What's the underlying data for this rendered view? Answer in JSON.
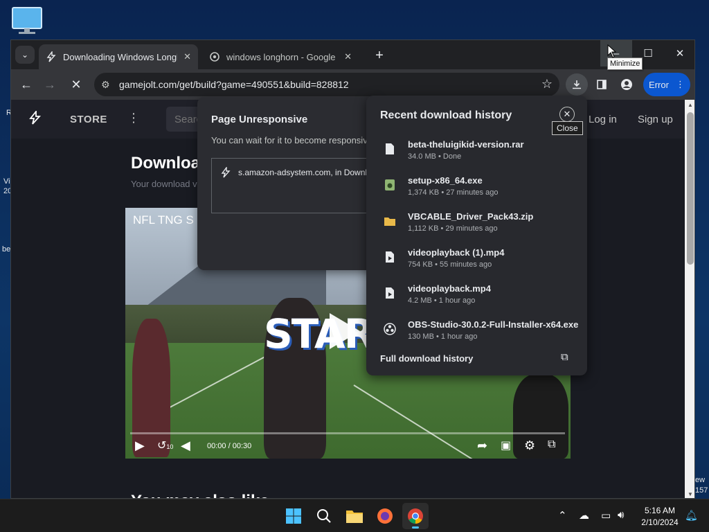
{
  "desktop": {
    "edge_labels": [
      "R",
      "Vi",
      "20",
      "be",
      "ew",
      "157"
    ]
  },
  "browser": {
    "tabs": [
      {
        "title": "Downloading Windows Longhe",
        "close": "✕"
      },
      {
        "title": "windows longhorn - Google Se",
        "close": "✕"
      }
    ],
    "new_tab": "+",
    "window_controls": {
      "minimize": "–",
      "maximize": "☐",
      "close": "✕"
    },
    "minimize_tooltip": "Minimize",
    "url": "gamejolt.com/get/build?game=490551&build=828812",
    "error_label": "Error"
  },
  "site": {
    "store_label": "STORE",
    "search_placeholder": "Search",
    "login_label": "Log in",
    "signup_label": "Sign up",
    "heading": "Downloa",
    "subtext": "Your download v",
    "bottom_heading": "You may also like"
  },
  "video": {
    "title": "NFL TNG S",
    "overlay_text": "STARRI",
    "current_time": "00:00",
    "separator": "/",
    "duration": "00:30",
    "progress_fraction": 0.0,
    "rewind_label": "10"
  },
  "unresponsive_dialog": {
    "title": "Page Unresponsive",
    "text": "You can wait for it to become responsiv",
    "item": "s.amazon-adsystem.com, in Downl"
  },
  "download_panel": {
    "title": "Recent download history",
    "close_tooltip": "Close",
    "items": [
      {
        "name": "beta-theluigikid-version.rar",
        "meta": "34.0 MB • Done",
        "icon": "file-icon"
      },
      {
        "name": "setup-x86_64.exe",
        "meta": "1,374 KB • 27 minutes ago",
        "icon": "installer-icon"
      },
      {
        "name": "VBCABLE_Driver_Pack43.zip",
        "meta": "1,112 KB • 29 minutes ago",
        "icon": "folder-zip-icon"
      },
      {
        "name": "videoplayback (1).mp4",
        "meta": "754 KB • 55 minutes ago",
        "icon": "video-file-icon"
      },
      {
        "name": "videoplayback.mp4",
        "meta": "4.2 MB • 1 hour ago",
        "icon": "video-file-icon"
      },
      {
        "name": "OBS-Studio-30.0.2-Full-Installer-x64.exe",
        "meta": "130 MB • 1 hour ago",
        "icon": "obs-icon"
      }
    ],
    "full_history_label": "Full download history"
  },
  "taskbar": {
    "time": "5:16 AM",
    "date": "2/10/2024"
  },
  "colors": {
    "accent_blue": "#0b57d0",
    "chrome_dark": "#202124",
    "panel_bg": "#28292e",
    "site_bg": "#191b22"
  }
}
